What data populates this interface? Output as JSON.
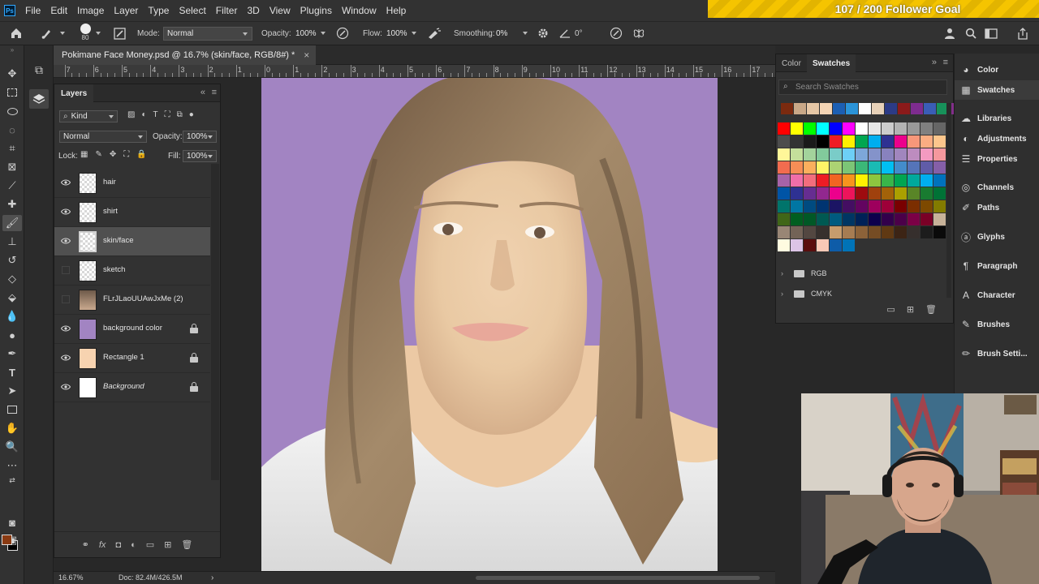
{
  "menu": [
    "File",
    "Edit",
    "Image",
    "Layer",
    "Type",
    "Select",
    "Filter",
    "3D",
    "View",
    "Plugins",
    "Window",
    "Help"
  ],
  "app_logo": "Ps",
  "goal_banner": "107 / 200 Follower Goal",
  "options": {
    "brush_size": "80",
    "mode_label": "Mode:",
    "mode_value": "Normal",
    "opacity_label": "Opacity:",
    "opacity_value": "100%",
    "flow_label": "Flow:",
    "flow_value": "100%",
    "smoothing_label": "Smoothing:",
    "smoothing_value": "0%",
    "angle_value": "0°"
  },
  "document": {
    "tab_title": "Pokimane Face Money.psd @ 16.7% (skin/face, RGB/8#) *",
    "ruler_labels": [
      "7",
      "6",
      "5",
      "4",
      "3",
      "2",
      "1",
      "0",
      "1",
      "2",
      "3",
      "4",
      "5",
      "6",
      "7",
      "8",
      "9",
      "10",
      "11",
      "12",
      "13",
      "14",
      "15",
      "16",
      "17"
    ],
    "zoom": "16.67%",
    "doc_size": "Doc: 82.4M/426.5M"
  },
  "layers_panel": {
    "tab": "Layers",
    "filter_kind": "Kind",
    "blend_mode": "Normal",
    "opacity_label": "Opacity:",
    "opacity_value": "100%",
    "lock_label": "Lock:",
    "fill_label": "Fill:",
    "fill_value": "100%",
    "layers": [
      {
        "name": "hair",
        "visible": true,
        "locked": false,
        "selected": false
      },
      {
        "name": "shirt",
        "visible": true,
        "locked": false,
        "selected": false
      },
      {
        "name": "skin/face",
        "visible": true,
        "locked": false,
        "selected": true
      },
      {
        "name": "sketch",
        "visible": false,
        "locked": false,
        "selected": false
      },
      {
        "name": "FLrJLaoUUAwJxMe (2)",
        "visible": false,
        "locked": false,
        "selected": false
      },
      {
        "name": "background color",
        "visible": true,
        "locked": true,
        "selected": false
      },
      {
        "name": "Rectangle 1",
        "visible": true,
        "locked": true,
        "selected": false
      },
      {
        "name": "Background",
        "visible": true,
        "locked": true,
        "selected": false
      }
    ]
  },
  "swatches_panel": {
    "tabs": [
      "Color",
      "Swatches"
    ],
    "active_tab": "Swatches",
    "search_placeholder": "Search Swatches",
    "recent": [
      "#7b2a0f",
      "#c9a888",
      "#e6c7a6",
      "#f4d4b4",
      "#1c5fb3",
      "#2b94d8",
      "#ffffff",
      "#e7d1b8",
      "#2c3b86",
      "#8b1a1a",
      "#7e2c8f",
      "#3a5db6",
      "#17915a",
      "#822e8a",
      "#c9a390"
    ],
    "grid": [
      "#ff0000",
      "#ffff00",
      "#00ff00",
      "#00ffff",
      "#0000ff",
      "#ff00ff",
      "#ffffff",
      "#e6e6e6",
      "#cccccc",
      "#b3b3b3",
      "#999999",
      "#808080",
      "#666666",
      "#4d4d4d",
      "#333333",
      "#1a1a1a",
      "#000000",
      "#ef1b24",
      "#ffef00",
      "#00a650",
      "#00aeef",
      "#2e3192",
      "#ec008c",
      "#f7977a",
      "#fbad82",
      "#fdc68c",
      "#fff799",
      "#c4df9b",
      "#a3d39c",
      "#82ca9c",
      "#7accc8",
      "#6dcff6",
      "#7da7d9",
      "#8493ca",
      "#8882be",
      "#a186be",
      "#bd8cbf",
      "#f49ac1",
      "#f5989d",
      "#f26c4f",
      "#f68e56",
      "#fbaf5d",
      "#fff467",
      "#acd373",
      "#7cc576",
      "#3bb878",
      "#1abbb4",
      "#00bff3",
      "#438ccb",
      "#5574b9",
      "#605ca8",
      "#855fa8",
      "#a763a8",
      "#f06ea9",
      "#f26d7d",
      "#ed1c24",
      "#f26522",
      "#f7941d",
      "#fff200",
      "#8dc63f",
      "#39b54a",
      "#00a651",
      "#00a99d",
      "#00aeef",
      "#0072bc",
      "#0054a6",
      "#2e3192",
      "#662d91",
      "#92278f",
      "#ec008c",
      "#ed145b",
      "#9e0b0f",
      "#a0410d",
      "#a36209",
      "#aba000",
      "#598527",
      "#197b30",
      "#007236",
      "#00746b",
      "#0076a3",
      "#004b80",
      "#003471",
      "#1b1464",
      "#440e62",
      "#630460",
      "#9e005d",
      "#9e0039",
      "#790000",
      "#7b2e00",
      "#7d4900",
      "#827b00",
      "#406618",
      "#005e20",
      "#005826",
      "#005952",
      "#005b7f",
      "#003663",
      "#002157",
      "#0d004c",
      "#32004b",
      "#4b0049",
      "#7b0046",
      "#7a0026",
      "#c7b299",
      "#998675",
      "#736357",
      "#534741",
      "#37302d",
      "#c69c6d",
      "#a67c52",
      "#8c6239",
      "#754c24",
      "#603913",
      "#3c2415",
      "#362f2d",
      "#1c1c1c",
      "#0a0a0a",
      "#fffbe0",
      "#dcc4e6",
      "#5a0e0e",
      "#f9c9b6",
      "#0e5ca8",
      "#0073b7"
    ],
    "groups": [
      "RGB",
      "CMYK"
    ]
  },
  "right_dock": [
    {
      "label": "Color",
      "icon": "color-wheel-icon"
    },
    {
      "label": "Swatches",
      "icon": "swatches-grid-icon"
    },
    {
      "label": "Libraries",
      "icon": "libraries-cloud-icon"
    },
    {
      "label": "Adjustments",
      "icon": "adjustments-circle-icon"
    },
    {
      "label": "Properties",
      "icon": "properties-sliders-icon"
    },
    {
      "label": "Channels",
      "icon": "channels-icon"
    },
    {
      "label": "Paths",
      "icon": "paths-icon"
    },
    {
      "label": "Glyphs",
      "icon": "glyphs-a-icon"
    },
    {
      "label": "Paragraph",
      "icon": "paragraph-icon"
    },
    {
      "label": "Character",
      "icon": "character-a-icon"
    },
    {
      "label": "Brushes",
      "icon": "brushes-icon"
    },
    {
      "label": "Brush Setti...",
      "icon": "brush-settings-icon"
    }
  ],
  "colors": {
    "canvas_background": "#a284c2",
    "foreground": "#8a3a12",
    "background": "#000000",
    "goal_banner": "#f5c400"
  }
}
